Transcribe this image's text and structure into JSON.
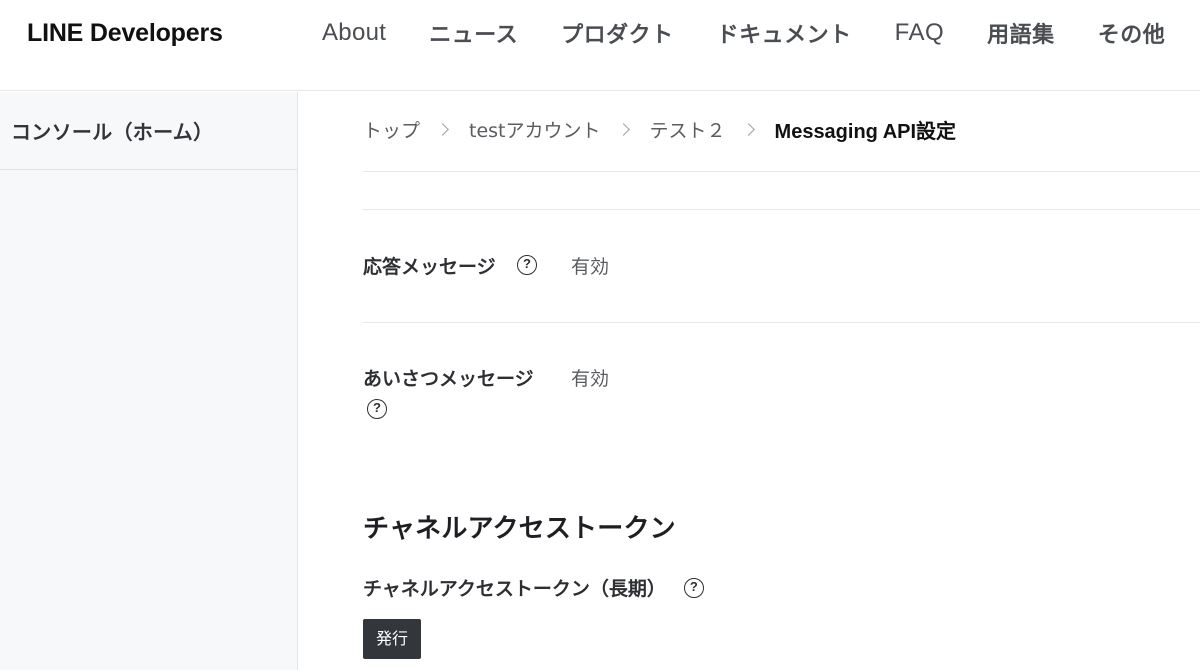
{
  "header": {
    "logo": "LINE Developers",
    "nav": [
      {
        "label": "About"
      },
      {
        "label": "ニュース"
      },
      {
        "label": "プロダクト"
      },
      {
        "label": "ドキュメント"
      },
      {
        "label": "FAQ"
      },
      {
        "label": "用語集"
      },
      {
        "label": "その他"
      }
    ]
  },
  "sidebar": {
    "home_label": "コンソール（ホーム）"
  },
  "breadcrumb": {
    "items": [
      "トップ",
      "testアカウント",
      "テスト２"
    ],
    "current": "Messaging API設定"
  },
  "settings": {
    "auto_reply": {
      "label": "応答メッセージ",
      "value": "有効",
      "help_icon": "question-circle-icon"
    },
    "greeting": {
      "label": "あいさつメッセージ",
      "value": "有効",
      "help_icon": "question-circle-icon"
    }
  },
  "token_section": {
    "heading": "チャネルアクセストークン",
    "subheading": "チャネルアクセストークン（長期）",
    "help_icon": "question-circle-icon",
    "issue_button_label": "発行"
  },
  "colors": {
    "sidebar_bg": "#f7f8fa",
    "button_bg": "#33363b",
    "nav_text": "#4a4d52"
  }
}
